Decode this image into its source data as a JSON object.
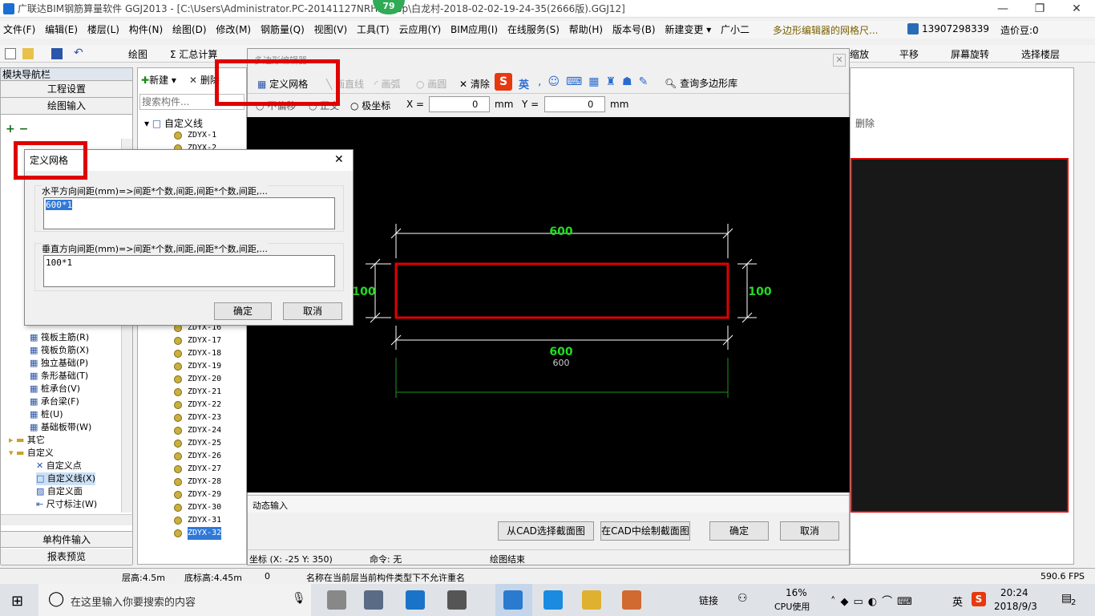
{
  "titlebar": {
    "text": "广联达BIM钢筋算量软件 GGJ2013 - [C:\\Users\\Administrator.PC-20141127NRH...ktop\\白龙村-2018-02-02-19-24-35(2666版).GGJ12]",
    "badge": "79"
  },
  "menu": [
    "文件(F)",
    "编辑(E)",
    "楼层(L)",
    "构件(N)",
    "绘图(D)",
    "修改(M)",
    "钢筋量(Q)",
    "视图(V)",
    "工具(T)",
    "云应用(Y)",
    "BIM应用(I)",
    "在线服务(S)",
    "帮助(H)",
    "版本号(B)",
    "新建变更 ▾",
    "广小二"
  ],
  "menu_right": {
    "marquee": "多边形编辑器的网格尺...",
    "phone": "13907298339",
    "price": "造价豆:0"
  },
  "toolbar2": {
    "draw": "绘图",
    "sum": "Σ 汇总计算",
    "zoom": "缩放",
    "pan": "平移",
    "rotate": "屏幕旋转",
    "select_floor": "选择楼层"
  },
  "leftnav": {
    "title": "模块导航栏",
    "project": "工程设置",
    "draw_input": "绘图输入",
    "items": [
      "筏板主筋(R)",
      "筏板负筋(X)",
      "独立基础(P)",
      "条形基础(T)",
      "桩承台(V)",
      "承台梁(F)",
      "桩(U)",
      "基础板带(W)"
    ],
    "other": "其它",
    "custom": "自定义",
    "custom_items": [
      "自定义点",
      "自定义线(X)",
      "自定义面",
      "尺寸标注(W)"
    ],
    "single": "单构件输入",
    "report": "报表预览"
  },
  "companel": {
    "new": "新建",
    "delete": "删除",
    "search_placeholder": "搜索构件...",
    "root": "自定义线",
    "items_top": [
      "ZDYX-1",
      "ZDYX-2"
    ],
    "items": [
      "ZDYX-16",
      "ZDYX-17",
      "ZDYX-18",
      "ZDYX-19",
      "ZDYX-20",
      "ZDYX-21",
      "ZDYX-22",
      "ZDYX-23",
      "ZDYX-24",
      "ZDYX-25",
      "ZDYX-26",
      "ZDYX-27",
      "ZDYX-28",
      "ZDYX-29",
      "ZDYX-30",
      "ZDYX-31",
      "ZDYX-32"
    ]
  },
  "editor": {
    "title": "多边形编辑器",
    "define_grid": "定义网格",
    "line": "画直线",
    "arc": "画弧",
    "circle": "画圆",
    "clear": "清除",
    "ime_en": "英",
    "query": "查询多边形库",
    "opt_ortho": "正交",
    "opt_polar": "极坐标",
    "opt_offset": "不偏移",
    "x_label": "X =",
    "x_value": "0",
    "y_label": "Y =",
    "y_value": "0",
    "unit": "mm",
    "dim_top": "600",
    "dim_bottom": "600",
    "dim_bottom_small": "600",
    "dim_left": "100",
    "dim_right": "100",
    "dynamic_tab": "动态输入",
    "btn_select_cad": "从CAD选择截面图",
    "btn_draw_cad": "在CAD中绘制截面图",
    "btn_ok": "确定",
    "btn_cancel": "取消",
    "coord": "坐标 (X: -25 Y: 350)",
    "command": "命令: 无",
    "draw_end": "绘图结束"
  },
  "dialog": {
    "title": "定义网格",
    "h_label": "水平方向间距(mm)=>间距*个数,间距,间距*个数,间距,...",
    "h_value": "600*1",
    "v_label": "垂直方向间距(mm)=>间距*个数,间距,间距*个数,间距,...",
    "v_value": "100*1",
    "ok": "确定",
    "cancel": "取消"
  },
  "right_panel": {
    "delete": "删除"
  },
  "statusbar": {
    "floor_height": "层高:4.5m",
    "base_height": "底标高:4.45m",
    "zero": "0",
    "message": "名称在当前层当前构件类型下不允许重名",
    "fps": "590.6 FPS"
  },
  "taskbar": {
    "search": "在这里输入你要搜索的内容",
    "link": "链接",
    "cpu": "16%",
    "cpu_label": "CPU使用",
    "ime": "英",
    "time": "20:24",
    "date": "2018/9/3",
    "notif": "2"
  }
}
